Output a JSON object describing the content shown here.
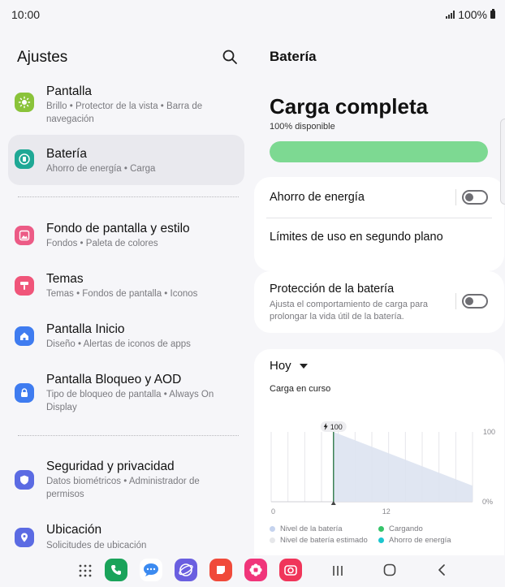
{
  "status": {
    "time": "10:00",
    "battery": "100%"
  },
  "left": {
    "title": "Ajustes",
    "items": [
      {
        "title": "Pantalla",
        "subtitle": "Brillo  •  Protector de la vista  •  Barra de navegación",
        "color": "#8ac33a",
        "icon": "sun-icon"
      },
      {
        "title": "Batería",
        "subtitle": "Ahorro de energía  •  Carga",
        "color": "#1fa895",
        "icon": "battery-icon"
      },
      {
        "title": "Fondo de pantalla y estilo",
        "subtitle": "Fondos  •  Paleta de colores",
        "color": "#ec5b86",
        "icon": "wallpaper-icon"
      },
      {
        "title": "Temas",
        "subtitle": "Temas  •  Fondos de pantalla  •  Iconos",
        "color": "#f0557a",
        "icon": "brush-icon"
      },
      {
        "title": "Pantalla Inicio",
        "subtitle": "Diseño  •  Alertas de iconos de apps",
        "color": "#3f7cf0",
        "icon": "home-icon"
      },
      {
        "title": "Pantalla Bloqueo y AOD",
        "subtitle": "Tipo de bloqueo de pantalla  •  Always On Display",
        "color": "#3f7cf0",
        "icon": "lock-icon"
      },
      {
        "title": "Seguridad y privacidad",
        "subtitle": "Datos biométricos  •  Administrador de permisos",
        "color": "#5b6be3",
        "icon": "shield-icon"
      },
      {
        "title": "Ubicación",
        "subtitle": "Solicitudes de ubicación",
        "color": "#5b6be3",
        "icon": "location-pin-icon"
      }
    ]
  },
  "right": {
    "title": "Batería",
    "hero_title": "Carga completa",
    "hero_sub": "100% disponible",
    "battery_level": 1.0,
    "power_saving": "Ahorro de energía",
    "background_limits": "Límites de uso en segundo plano",
    "protection_title": "Protección de la batería",
    "protection_sub": "Ajusta el comportamiento de carga para prolongar la vida útil de la batería.",
    "period": "Hoy",
    "chart_label": "Carga en curso"
  },
  "chart_data": {
    "type": "area",
    "x_ticks": [
      "0",
      "12"
    ],
    "y_ticks": [
      "100",
      "0%"
    ],
    "badge": "100",
    "points": [
      {
        "hour": 6.5,
        "level": 100
      },
      {
        "hour": 21,
        "level": 23
      }
    ],
    "xlim": [
      0,
      21
    ],
    "ylim": [
      0,
      100
    ],
    "legend": [
      {
        "label": "Nivel de la batería",
        "color": "#c5d3ee"
      },
      {
        "label": "Cargando",
        "color": "#36c46a"
      },
      {
        "label": "Nivel de batería estimado",
        "color": "#e6e7ea"
      },
      {
        "label": "Ahorro de energía",
        "color": "#1cc6cf"
      }
    ]
  },
  "nav": {
    "apps": [
      {
        "name": "phone-app-icon",
        "color": "#1aa35a"
      },
      {
        "name": "messages-app-icon",
        "color": "#ffffff"
      },
      {
        "name": "internet-app-icon",
        "color": "#6a5fe0"
      },
      {
        "name": "notes-app-icon",
        "color": "#f04a3a"
      },
      {
        "name": "gallery-app-icon",
        "color": "#f0357a"
      },
      {
        "name": "camera-app-icon",
        "color": "#f0355a"
      }
    ]
  }
}
